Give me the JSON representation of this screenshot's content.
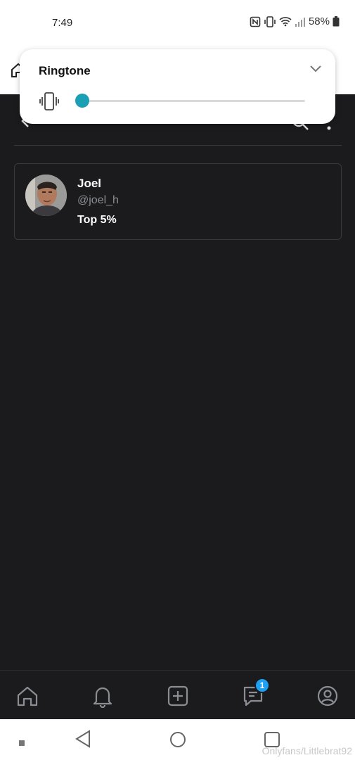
{
  "status_bar": {
    "time": "7:49",
    "battery": "58%"
  },
  "volume_popup": {
    "title": "Ringtone",
    "level": 0.0
  },
  "user_card": {
    "name": "Joel",
    "handle": "@joel_h",
    "rank": "Top 5%"
  },
  "bottom_nav": {
    "items": [
      "home-icon",
      "bell-icon",
      "add-post-icon",
      "messages-icon",
      "profile-icon"
    ],
    "messages_badge": "1"
  },
  "watermark": "Onlyfans/Littlebrat92",
  "colors": {
    "background": "#1b1b1d",
    "slider_accent": "#1a9fb5",
    "badge": "#1da1f2"
  }
}
